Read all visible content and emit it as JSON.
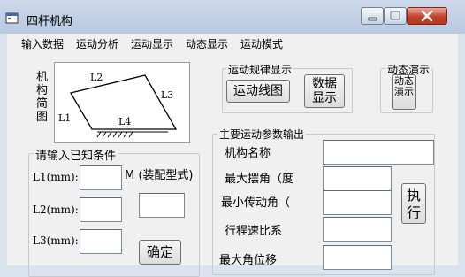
{
  "window": {
    "title": "四杆机构",
    "icon": "form-icon"
  },
  "menu": [
    "输入数据",
    "运动分析",
    "运动显示",
    "动态显示",
    "运动模式"
  ],
  "mechanism": {
    "vertical_label": "机构简图",
    "links": {
      "l1": "L1",
      "l2": "L2",
      "l3": "L3",
      "l4": "L4"
    }
  },
  "motion_display": {
    "caption": "运动规律显示",
    "button": "运动线图",
    "data_button": "数据显示"
  },
  "dynamic_demo": {
    "caption": "动态演示",
    "button": "动态演示"
  },
  "input": {
    "caption": "请输入已知条件",
    "l1_label": "L1(mm):",
    "l2_label": "L2(mm):",
    "l3_label": "L3(mm):",
    "m_label": "M (装配型式)",
    "l1_value": "",
    "l2_value": "",
    "l3_value": "",
    "m_value": "",
    "confirm_button": "确定"
  },
  "output": {
    "caption": "主要运动参数输出",
    "mechanism_name_label": "机构名称",
    "max_swing_label": "最大摆角（度",
    "min_trans_label": "最小传动角（",
    "travel_ratio_label": "行程速比系",
    "max_pos_label": "最大角位移",
    "values": [
      "",
      "",
      "",
      "",
      ""
    ],
    "execute_button": "执行"
  }
}
